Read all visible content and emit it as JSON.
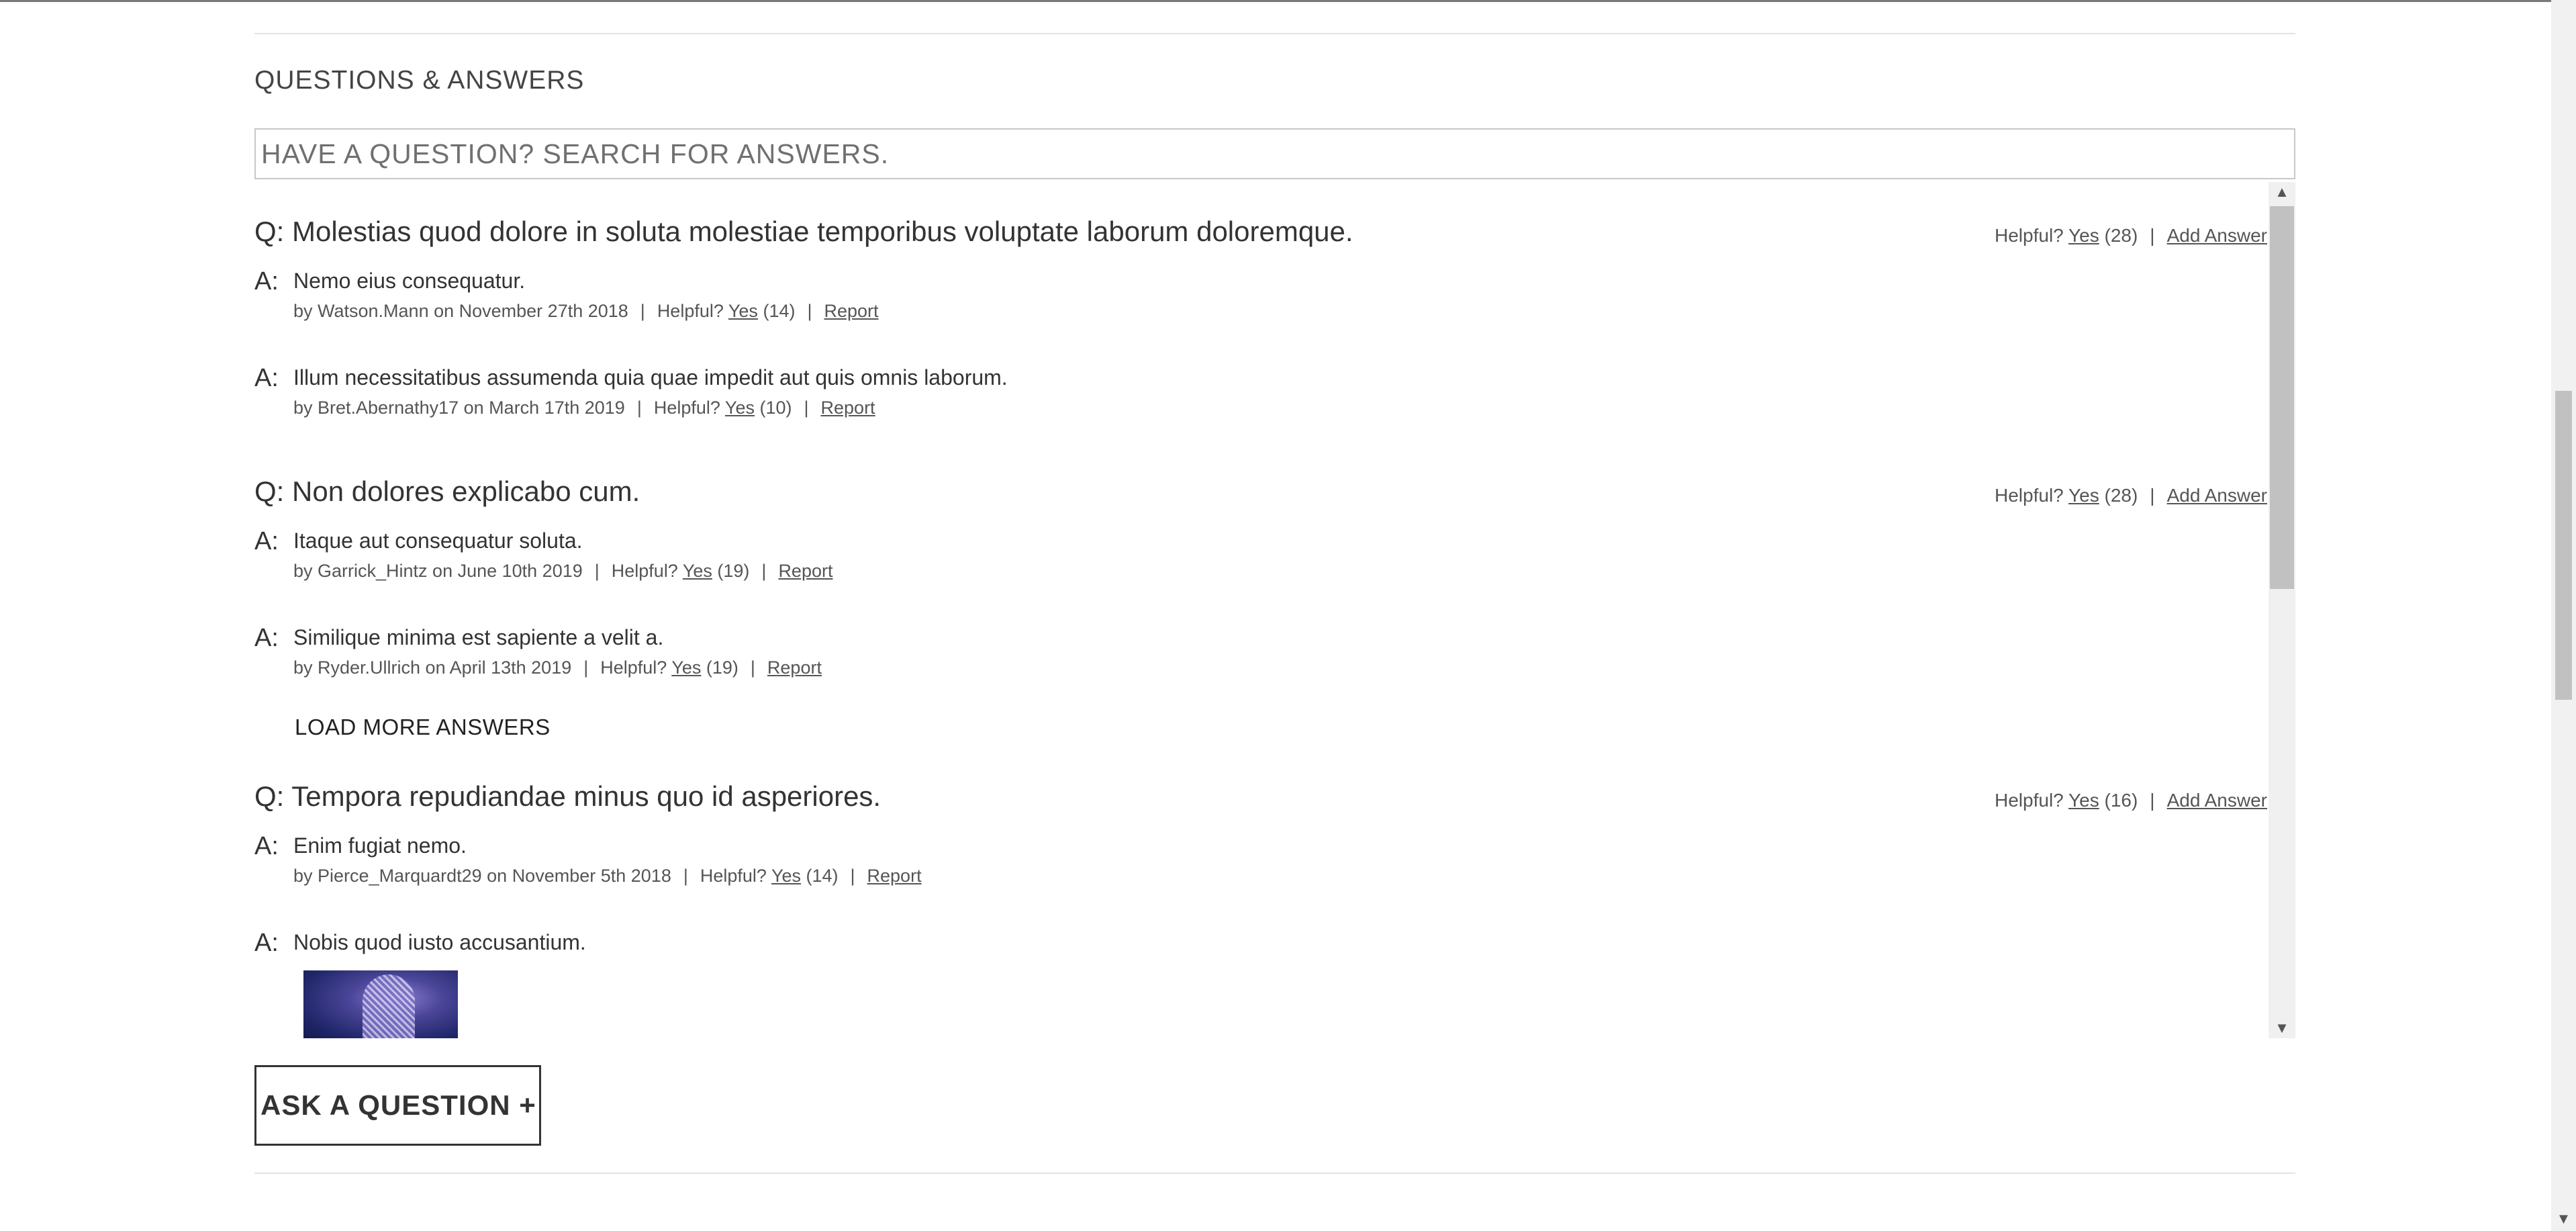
{
  "section": {
    "title": "QUESTIONS & ANSWERS",
    "search_placeholder": "HAVE A QUESTION? SEARCH FOR ANSWERS."
  },
  "helpful_label": "Helpful?",
  "yes_label": "Yes",
  "report_label": "Report",
  "add_answer_label": "Add Answer",
  "answer_prefix": "A:",
  "questions": [
    {
      "text": "Q: Molestias quod dolore in soluta molestiae temporibus voluptate laborum doloremque.",
      "helpful_count": "(28)",
      "answers": [
        {
          "body": "Nemo eius consequatur.",
          "byline": "by Watson.Mann on November 27th 2018",
          "helpful_count": "(14)"
        },
        {
          "body": "Illum necessitatibus assumenda quia quae impedit aut quis omnis laborum.",
          "byline": "by Bret.Abernathy17 on March 17th 2019",
          "helpful_count": "(10)"
        }
      ]
    },
    {
      "text": "Q: Non dolores explicabo cum.",
      "helpful_count": "(28)",
      "answers": [
        {
          "body": "Itaque aut consequatur soluta.",
          "byline": "by Garrick_Hintz on June 10th 2019",
          "helpful_count": "(19)"
        },
        {
          "body": "Similique minima est sapiente a velit a.",
          "byline": "by Ryder.Ullrich on April 13th 2019",
          "helpful_count": "(19)"
        }
      ],
      "load_more_label": "LOAD MORE ANSWERS"
    },
    {
      "text": "Q: Tempora repudiandae minus quo id asperiores.",
      "helpful_count": "(16)",
      "answers": [
        {
          "body": "Enim fugiat nemo.",
          "byline": "by Pierce_Marquardt29 on November 5th 2018",
          "helpful_count": "(14)"
        },
        {
          "body": "Nobis quod iusto accusantium."
        }
      ]
    }
  ],
  "ask_question_label": "ASK A QUESTION +",
  "icons": {
    "scroll_up": "▲",
    "scroll_down": "▼"
  }
}
